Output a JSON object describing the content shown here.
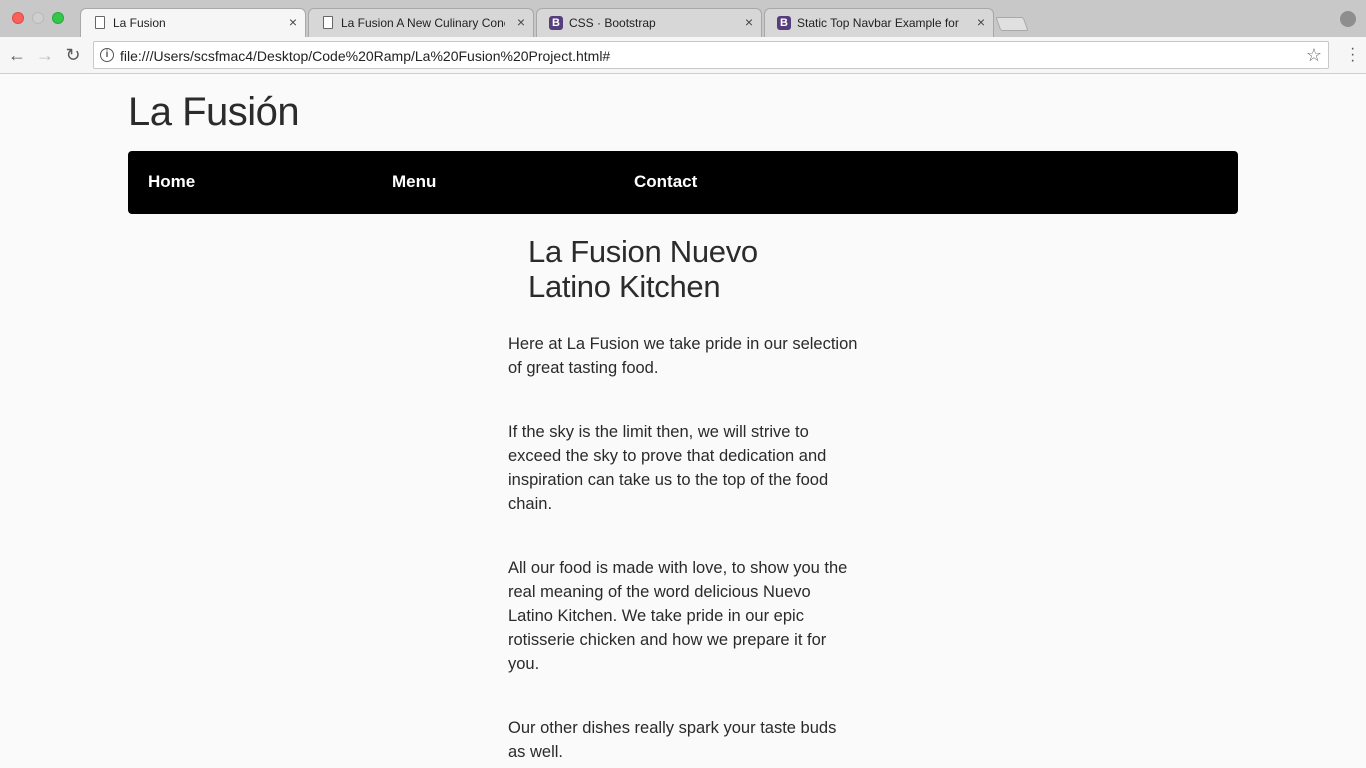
{
  "browser": {
    "tabs": [
      {
        "title": "La Fusion",
        "icon": "page-icon",
        "active": true
      },
      {
        "title": "La Fusion A New Culinary Conc",
        "icon": "page-icon",
        "active": false
      },
      {
        "title": "CSS · Bootstrap",
        "icon": "bootstrap-icon",
        "active": false
      },
      {
        "title": "Static Top Navbar Example for",
        "icon": "bootstrap-icon",
        "active": false
      }
    ],
    "tab_close_glyph": "×",
    "bootstrap_glyph": "B",
    "address": "file:///Users/scsfmac4/Desktop/Code%20Ramp/La%20Fusion%20Project.html#"
  },
  "page": {
    "site_title": "La Fusión",
    "nav": {
      "home": "Home",
      "menu": "Menu",
      "contact": "Contact"
    },
    "heading_line1": "La Fusion Nuevo",
    "heading_line2": "Latino Kitchen",
    "paragraphs": [
      "Here at La Fusion we take pride in our selection of great tasting food.",
      "If the sky is the limit then, we will strive to exceed the sky to prove that dedication and inspiration can take us to the top of the food chain.",
      "All our food is made with love, to show you the real meaning of the word delicious Nuevo Latino Kitchen. We take pride in our epic rotisserie chicken and how we prepare it for you.",
      "Our other dishes really spark your taste buds as well."
    ]
  },
  "colors": {
    "navbar_bg": "#000000",
    "page_bg": "#fafafa",
    "bootstrap_purple": "#563d7c"
  }
}
